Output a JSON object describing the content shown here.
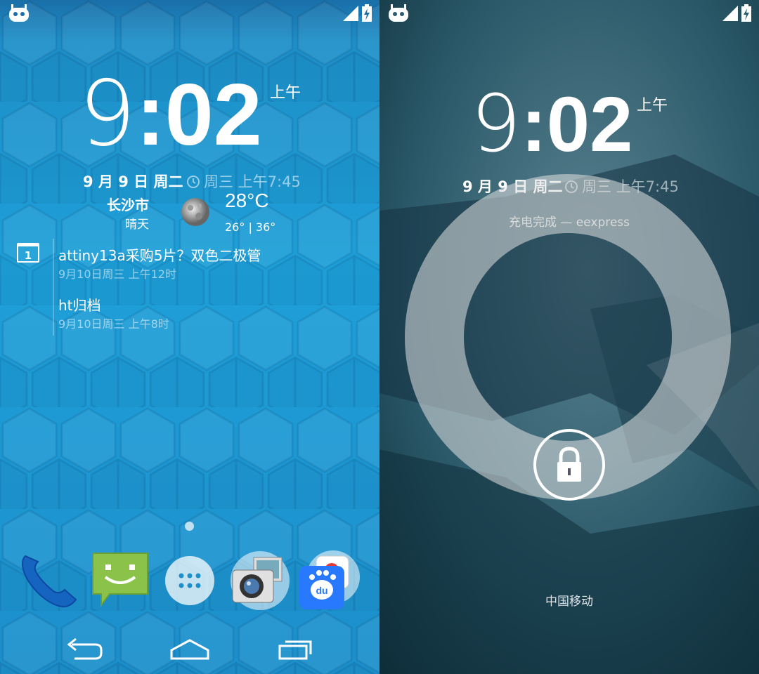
{
  "home": {
    "clock": {
      "hour": "9",
      "minute": ":02",
      "ampm": "上午"
    },
    "date": "9 月 9 日 周二",
    "alarm": "周三 上午7:45",
    "weather": {
      "city": "长沙市",
      "condition": "晴天",
      "temp": "28°C",
      "range": "26° | 36°"
    },
    "calendar": {
      "icon_label": "1",
      "events": [
        {
          "title": "attiny13a采购5片？双色二极管",
          "time": "9月10日周三 上午12时"
        },
        {
          "title": "ht归档",
          "time": "9月10日周三 上午8时"
        }
      ]
    },
    "dock": [
      "phone-icon",
      "messaging-icon",
      "app-drawer-icon",
      "camera-gallery-folder-icon",
      "baidu-folder-icon"
    ],
    "nav": [
      "back-icon",
      "home-icon",
      "recents-icon"
    ]
  },
  "lock": {
    "clock": {
      "hour": "9",
      "minute": ":02",
      "ampm": "上午"
    },
    "date": "9 月 9 日 周二",
    "alarm": "周三 上午7:45",
    "charging": "充电完成 — eexpress",
    "carrier": "中国移动"
  },
  "colors": {
    "home_bg": "#1e9fd8",
    "lock_bg": "#2b5e6e",
    "ring": "#e1e1e1"
  }
}
